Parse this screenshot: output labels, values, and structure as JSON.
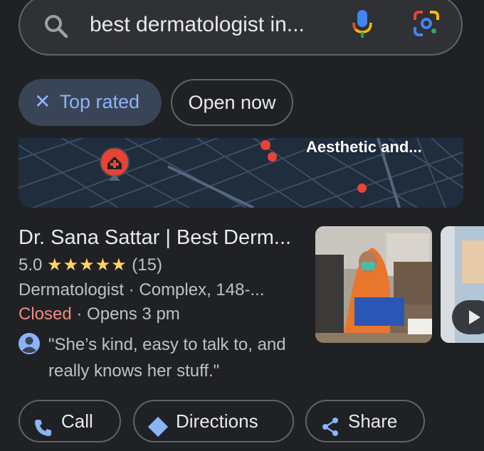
{
  "search": {
    "query": "best dermatologist in..."
  },
  "chips": {
    "top_rated": "Top rated",
    "open_now": "Open now"
  },
  "map": {
    "label": "Aesthetic and..."
  },
  "result": {
    "title": "Dr. Sana Sattar | Best Derm...",
    "rating": "5.0",
    "stars": "★★★★★",
    "review_count": "(15)",
    "category": "Dermatologist · Complex, 148-...",
    "status": "Closed",
    "hours": " · Opens 3 pm",
    "review": "\"She’s kind, easy to talk to, and really knows her stuff.\""
  },
  "actions": {
    "call": "Call",
    "directions": "Directions",
    "share": "Share"
  },
  "colors": {
    "background": "#202124",
    "chip_selected_bg": "#394457",
    "accent_blue": "#8ab4f8",
    "closed_red": "#f28b82",
    "star_yellow": "#fdd663",
    "map_marker": "#ea4335"
  },
  "icons": {
    "search": "search-icon",
    "mic": "mic-icon",
    "lens": "google-lens-icon",
    "close": "close-icon",
    "marker": "medical-marker-icon",
    "avatar": "user-avatar-icon",
    "play": "play-icon",
    "call": "phone-icon",
    "directions": "directions-icon",
    "share": "share-icon"
  }
}
